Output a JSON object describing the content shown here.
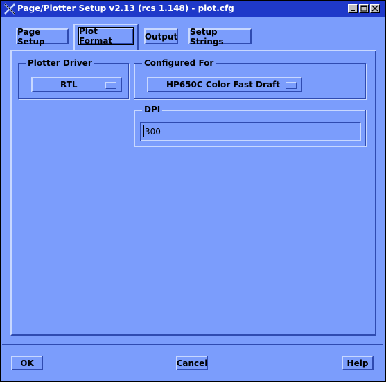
{
  "window": {
    "title": "Page/Plotter Setup v2.13 (rcs 1.148) - plot.cfg",
    "icon": "x-window-icon",
    "controls": [
      "minimize-icon",
      "maximize-icon",
      "close-icon"
    ]
  },
  "tabs": [
    {
      "label": "Page Setup",
      "active": false
    },
    {
      "label": "Plot Format",
      "active": true
    },
    {
      "label": "Output",
      "active": false
    },
    {
      "label": "Setup Strings",
      "active": false
    }
  ],
  "plotter_driver": {
    "legend": "Plotter Driver",
    "selected": "RTL"
  },
  "configured_for": {
    "legend": "Configured For",
    "selected": "HP650C Color Fast Draft"
  },
  "dpi": {
    "legend": "DPI",
    "value": "300"
  },
  "buttons": {
    "ok": "OK",
    "cancel": "Cancel",
    "help": "Help"
  },
  "colors": {
    "background": "#7b9dfc",
    "titlebar": "#1f39c9",
    "highlight": "#c8d8ff",
    "shadow": "#2f4bb0"
  }
}
